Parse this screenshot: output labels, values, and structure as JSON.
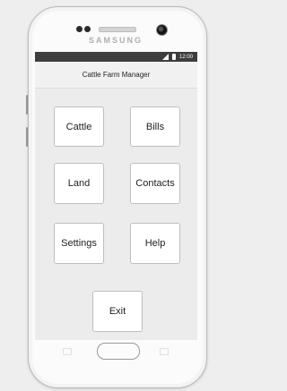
{
  "device": {
    "brand": "SAMSUNG"
  },
  "statusbar": {
    "time": "12:00",
    "icons": [
      "signal-icon",
      "battery-icon"
    ]
  },
  "app": {
    "title": "Cattle Farm Manager"
  },
  "menu": {
    "cattle": "Cattle",
    "bills": "Bills",
    "land": "Land",
    "contacts": "Contacts",
    "settings": "Settings",
    "help": "Help",
    "exit": "Exit"
  }
}
